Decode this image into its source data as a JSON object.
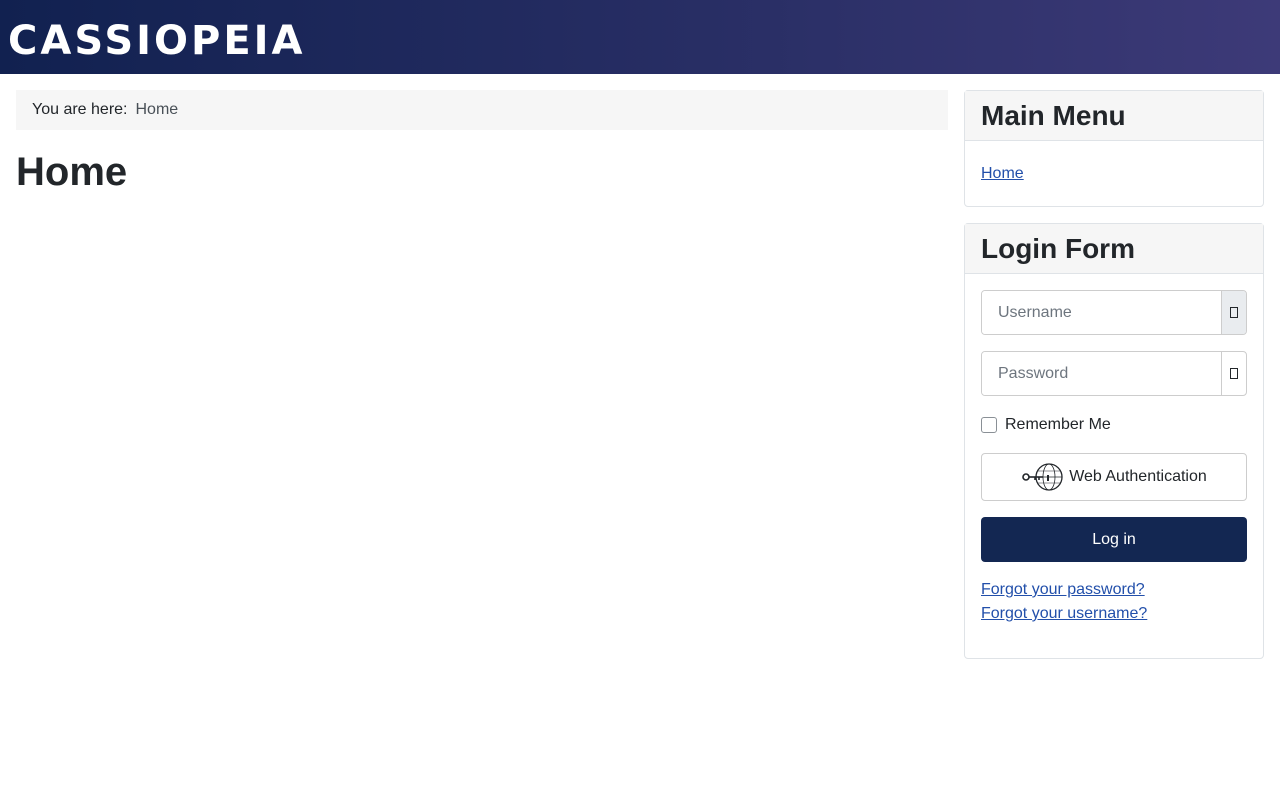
{
  "header": {
    "brand": "CASSIOPEIA"
  },
  "breadcrumb": {
    "label": "You are here:",
    "items": [
      "Home"
    ]
  },
  "page": {
    "title": "Home"
  },
  "main_menu": {
    "title": "Main Menu",
    "items": [
      {
        "label": "Home"
      }
    ]
  },
  "login_form": {
    "title": "Login Form",
    "username_placeholder": "Username",
    "password_placeholder": "Password",
    "remember_label": "Remember Me",
    "webauthn_label": "Web Authentication",
    "login_label": "Log in",
    "forgot_password": "Forgot your password?",
    "forgot_username": "Forgot your username?"
  },
  "colors": {
    "header_start": "#112150",
    "header_end": "#3d3a78",
    "primary_button": "#132752",
    "link": "#224faa"
  },
  "icons": [
    "user-icon",
    "eye-icon",
    "webauthn-key-icon"
  ]
}
